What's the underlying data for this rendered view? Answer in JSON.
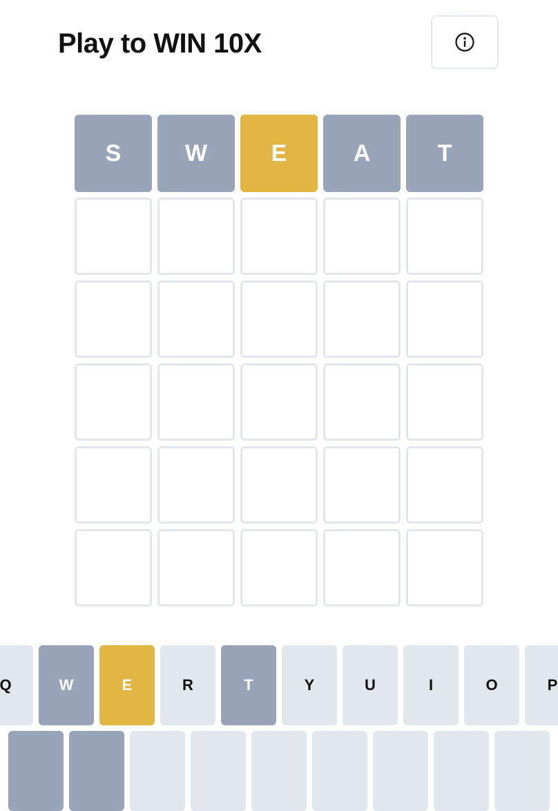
{
  "header": {
    "title": "Play to WIN 10X",
    "info_icon": "info-circle-icon"
  },
  "colors": {
    "absent": "#98a5b8",
    "present": "#e1b541",
    "empty_border": "#e3e7ec",
    "key_default": "#e2e7ee"
  },
  "board": {
    "rows": [
      [
        {
          "letter": "S",
          "state": "absent"
        },
        {
          "letter": "W",
          "state": "absent"
        },
        {
          "letter": "E",
          "state": "present"
        },
        {
          "letter": "A",
          "state": "absent"
        },
        {
          "letter": "T",
          "state": "absent"
        }
      ],
      [
        {
          "letter": "",
          "state": "empty"
        },
        {
          "letter": "",
          "state": "empty"
        },
        {
          "letter": "",
          "state": "empty"
        },
        {
          "letter": "",
          "state": "empty"
        },
        {
          "letter": "",
          "state": "empty"
        }
      ],
      [
        {
          "letter": "",
          "state": "empty"
        },
        {
          "letter": "",
          "state": "empty"
        },
        {
          "letter": "",
          "state": "empty"
        },
        {
          "letter": "",
          "state": "empty"
        },
        {
          "letter": "",
          "state": "empty"
        }
      ],
      [
        {
          "letter": "",
          "state": "empty"
        },
        {
          "letter": "",
          "state": "empty"
        },
        {
          "letter": "",
          "state": "empty"
        },
        {
          "letter": "",
          "state": "empty"
        },
        {
          "letter": "",
          "state": "empty"
        }
      ],
      [
        {
          "letter": "",
          "state": "empty"
        },
        {
          "letter": "",
          "state": "empty"
        },
        {
          "letter": "",
          "state": "empty"
        },
        {
          "letter": "",
          "state": "empty"
        },
        {
          "letter": "",
          "state": "empty"
        }
      ],
      [
        {
          "letter": "",
          "state": "empty"
        },
        {
          "letter": "",
          "state": "empty"
        },
        {
          "letter": "",
          "state": "empty"
        },
        {
          "letter": "",
          "state": "empty"
        },
        {
          "letter": "",
          "state": "empty"
        }
      ]
    ]
  },
  "keyboard": {
    "row1": [
      {
        "key": "Q",
        "state": "default"
      },
      {
        "key": "W",
        "state": "absent"
      },
      {
        "key": "E",
        "state": "present"
      },
      {
        "key": "R",
        "state": "default"
      },
      {
        "key": "T",
        "state": "absent"
      },
      {
        "key": "Y",
        "state": "default"
      },
      {
        "key": "U",
        "state": "default"
      },
      {
        "key": "I",
        "state": "default"
      },
      {
        "key": "O",
        "state": "default"
      },
      {
        "key": "P",
        "state": "default"
      }
    ],
    "row2": [
      {
        "key": "",
        "state": "absent"
      },
      {
        "key": "",
        "state": "absent"
      },
      {
        "key": "",
        "state": "default"
      },
      {
        "key": "",
        "state": "default"
      },
      {
        "key": "",
        "state": "default"
      },
      {
        "key": "",
        "state": "default"
      },
      {
        "key": "",
        "state": "default"
      },
      {
        "key": "",
        "state": "default"
      },
      {
        "key": "",
        "state": "default"
      }
    ]
  }
}
